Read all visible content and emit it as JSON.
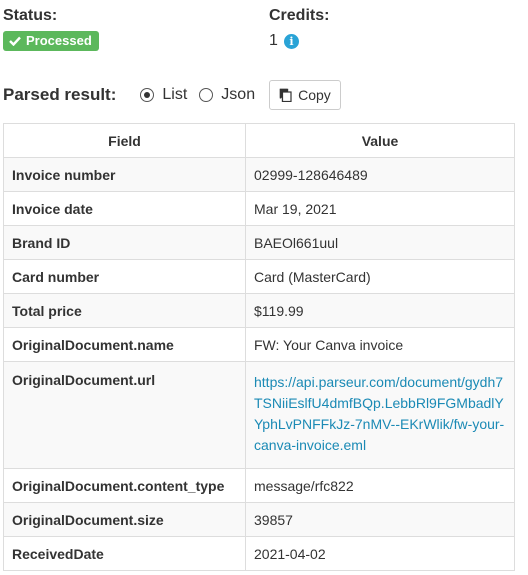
{
  "status": {
    "heading": "Status:",
    "badge": "Processed"
  },
  "credits": {
    "heading": "Credits:",
    "value": "1",
    "info_icon": "info-icon"
  },
  "parsed": {
    "label": "Parsed result:",
    "options": [
      {
        "label": "List",
        "selected": true
      },
      {
        "label": "Json",
        "selected": false
      }
    ],
    "copy_label": "Copy"
  },
  "table": {
    "headers": [
      "Field",
      "Value"
    ],
    "rows": [
      {
        "field": "Invoice number",
        "value": "02999-128646489"
      },
      {
        "field": "Invoice date",
        "value": "Mar 19, 2021"
      },
      {
        "field": "Brand ID",
        "value": "BAEOl661uul"
      },
      {
        "field": "Card number",
        "value": "Card (MasterCard)"
      },
      {
        "field": "Total price",
        "value": "$119.99"
      },
      {
        "field": "OriginalDocument.name",
        "value": "FW: Your Canva invoice"
      },
      {
        "field": "OriginalDocument.url",
        "value": "https://api.parseur.com/document/gydh7TSNiiEslfU4dmfBQp.LebbRl9FGMbadlYYphLvPNFFkJz-7nMV--EKrWlik/fw-your-canva-invoice.eml"
      },
      {
        "field": "OriginalDocument.content_type",
        "value": "message/rfc822"
      },
      {
        "field": "OriginalDocument.size",
        "value": "39857"
      },
      {
        "field": "ReceivedDate",
        "value": "2021-04-02"
      }
    ]
  },
  "colors": {
    "success": "#5cb85c",
    "info": "#29a3d6",
    "link": "#1b8ab5"
  }
}
